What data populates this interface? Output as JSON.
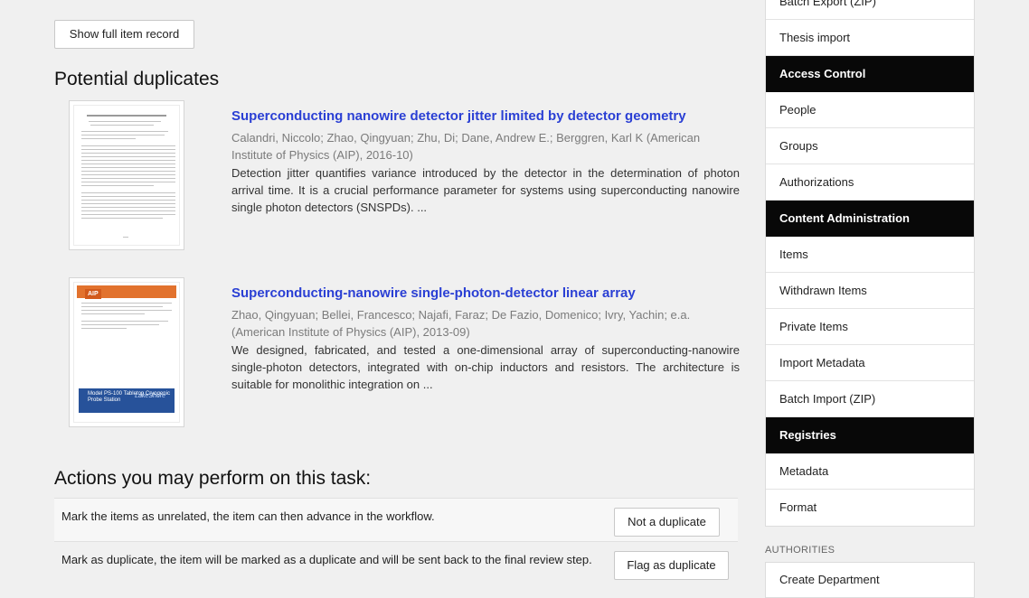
{
  "main": {
    "show_full_record_label": "Show full item record",
    "duplicates_heading": "Potential duplicates",
    "duplicates": [
      {
        "title": "Superconducting nanowire detector jitter limited by detector geometry",
        "authors": "Calandri, Niccolo; Zhao, Qingyuan; Zhu, Di; Dane, Andrew E.; Berggren, Karl K (American Institute of Physics (AIP), 2016-10)",
        "abstract": "Detection jitter quantifies variance introduced by the detector in the determination of photon arrival time. It is a crucial performance parameter for systems using superconducting nanowire single photon detectors (SNSPDs). ..."
      },
      {
        "title": "Superconducting-nanowire single-photon-detector linear array",
        "authors": "Zhao, Qingyuan; Bellei, Francesco; Najafi, Faraz; De Fazio, Domenico; Ivry, Yachin; e.a. (American Institute of Physics (AIP), 2013-09)",
        "abstract": "We designed, fabricated, and tested a one-dimensional array of superconducting-nanowire single-photon detectors, integrated with on-chip inductors and resistors. The architecture is suitable for monolithic integration on ..."
      }
    ],
    "actions_heading": "Actions you may perform on this task:",
    "actions": [
      {
        "text": "Mark the items as unrelated, the item can then advance in the workflow.",
        "button": "Not a duplicate"
      },
      {
        "text": "Mark as duplicate, the item will be marked as a duplicate and will be sent back to the final review step.",
        "button": "Flag as duplicate"
      }
    ]
  },
  "sidebar": {
    "items": [
      {
        "label": "Batch Export (ZIP)",
        "type": "link"
      },
      {
        "label": "Thesis import",
        "type": "link"
      },
      {
        "label": "Access Control",
        "type": "header"
      },
      {
        "label": "People",
        "type": "link"
      },
      {
        "label": "Groups",
        "type": "link"
      },
      {
        "label": "Authorizations",
        "type": "link"
      },
      {
        "label": "Content Administration",
        "type": "header"
      },
      {
        "label": "Items",
        "type": "link"
      },
      {
        "label": "Withdrawn Items",
        "type": "link"
      },
      {
        "label": "Private Items",
        "type": "link"
      },
      {
        "label": "Import Metadata",
        "type": "link"
      },
      {
        "label": "Batch Import (ZIP)",
        "type": "link"
      },
      {
        "label": "Registries",
        "type": "header"
      },
      {
        "label": "Metadata",
        "type": "link"
      },
      {
        "label": "Format",
        "type": "link"
      }
    ],
    "authorities_label": "AUTHORITIES",
    "authorities_items": [
      {
        "label": "Create Department"
      }
    ]
  },
  "thumbnails": {
    "aip_logo": "AIP",
    "ad_text": "Model PS-100 Tabletop Cryogenic Probe Station",
    "ad_brand": "LakeShore"
  }
}
